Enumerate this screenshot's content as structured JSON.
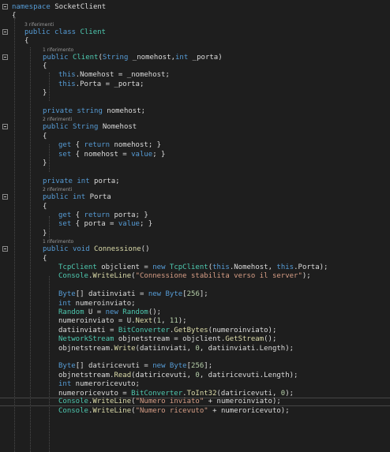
{
  "editor": {
    "lines": [
      {
        "indent": 0,
        "tokens": [
          [
            "kw",
            "namespace"
          ],
          [
            "plain",
            " SocketClient"
          ]
        ]
      },
      {
        "indent": 0,
        "tokens": [
          [
            "punct",
            "{"
          ]
        ]
      },
      {
        "lens": "3 riferimenti"
      },
      {
        "indent": 1,
        "tokens": [
          [
            "kw",
            "public"
          ],
          [
            "plain",
            " "
          ],
          [
            "kw",
            "class"
          ],
          [
            "plain",
            " "
          ],
          [
            "type",
            "Client"
          ]
        ]
      },
      {
        "indent": 1,
        "tokens": [
          [
            "punct",
            "{"
          ]
        ]
      },
      {
        "lens": "1 riferimento"
      },
      {
        "indent": 2,
        "tokens": [
          [
            "kw",
            "public"
          ],
          [
            "plain",
            " "
          ],
          [
            "type",
            "Client"
          ],
          [
            "punct",
            "("
          ],
          [
            "kw",
            "String"
          ],
          [
            "plain",
            " _nomehost,"
          ],
          [
            "kw",
            "int"
          ],
          [
            "plain",
            " _porta)"
          ]
        ]
      },
      {
        "indent": 2,
        "tokens": [
          [
            "punct",
            "{"
          ]
        ]
      },
      {
        "indent": 3,
        "tokens": [
          [
            "kw",
            "this"
          ],
          [
            "plain",
            ".Nomehost = _nomehost;"
          ]
        ]
      },
      {
        "indent": 3,
        "tokens": [
          [
            "kw",
            "this"
          ],
          [
            "plain",
            ".Porta = _porta;"
          ]
        ]
      },
      {
        "indent": 2,
        "tokens": [
          [
            "punct",
            "}"
          ]
        ]
      },
      {
        "indent": 0,
        "tokens": []
      },
      {
        "indent": 2,
        "tokens": [
          [
            "kw",
            "private"
          ],
          [
            "plain",
            " "
          ],
          [
            "kw",
            "string"
          ],
          [
            "plain",
            " nomehost;"
          ]
        ]
      },
      {
        "lens": "2 riferimenti"
      },
      {
        "indent": 2,
        "tokens": [
          [
            "kw",
            "public"
          ],
          [
            "plain",
            " "
          ],
          [
            "kw",
            "String"
          ],
          [
            "plain",
            " Nomehost"
          ]
        ]
      },
      {
        "indent": 2,
        "tokens": [
          [
            "punct",
            "{"
          ]
        ]
      },
      {
        "indent": 3,
        "tokens": [
          [
            "kw",
            "get"
          ],
          [
            "plain",
            " { "
          ],
          [
            "kw",
            "return"
          ],
          [
            "plain",
            " nomehost; }"
          ]
        ]
      },
      {
        "indent": 3,
        "tokens": [
          [
            "kw",
            "set"
          ],
          [
            "plain",
            " { nomehost = "
          ],
          [
            "kw",
            "value"
          ],
          [
            "plain",
            "; }"
          ]
        ]
      },
      {
        "indent": 2,
        "tokens": [
          [
            "punct",
            "}"
          ]
        ]
      },
      {
        "indent": 0,
        "tokens": []
      },
      {
        "indent": 2,
        "tokens": [
          [
            "kw",
            "private"
          ],
          [
            "plain",
            " "
          ],
          [
            "kw",
            "int"
          ],
          [
            "plain",
            " porta;"
          ]
        ]
      },
      {
        "lens": "2 riferimenti"
      },
      {
        "indent": 2,
        "tokens": [
          [
            "kw",
            "public"
          ],
          [
            "plain",
            " "
          ],
          [
            "kw",
            "int"
          ],
          [
            "plain",
            " Porta"
          ]
        ]
      },
      {
        "indent": 2,
        "tokens": [
          [
            "punct",
            "{"
          ]
        ]
      },
      {
        "indent": 3,
        "tokens": [
          [
            "kw",
            "get"
          ],
          [
            "plain",
            " { "
          ],
          [
            "kw",
            "return"
          ],
          [
            "plain",
            " porta; }"
          ]
        ]
      },
      {
        "indent": 3,
        "tokens": [
          [
            "kw",
            "set"
          ],
          [
            "plain",
            " { porta = "
          ],
          [
            "kw",
            "value"
          ],
          [
            "plain",
            "; }"
          ]
        ]
      },
      {
        "indent": 2,
        "tokens": [
          [
            "punct",
            "}"
          ]
        ]
      },
      {
        "lens": "1 riferimento"
      },
      {
        "indent": 2,
        "tokens": [
          [
            "kw",
            "public"
          ],
          [
            "plain",
            " "
          ],
          [
            "kw",
            "void"
          ],
          [
            "plain",
            " "
          ],
          [
            "method",
            "Connessione"
          ],
          [
            "plain",
            "()"
          ]
        ]
      },
      {
        "indent": 2,
        "tokens": [
          [
            "punct",
            "{"
          ]
        ]
      },
      {
        "indent": 3,
        "tokens": [
          [
            "type",
            "TcpClient"
          ],
          [
            "plain",
            " objclient = "
          ],
          [
            "kw",
            "new"
          ],
          [
            "plain",
            " "
          ],
          [
            "type",
            "TcpClient"
          ],
          [
            "plain",
            "("
          ],
          [
            "kw",
            "this"
          ],
          [
            "plain",
            ".Nomehost, "
          ],
          [
            "kw",
            "this"
          ],
          [
            "plain",
            ".Porta);"
          ]
        ]
      },
      {
        "indent": 3,
        "tokens": [
          [
            "type",
            "Console"
          ],
          [
            "plain",
            "."
          ],
          [
            "method",
            "WriteLine"
          ],
          [
            "plain",
            "("
          ],
          [
            "str",
            "\"Connessione stabilita verso il server\""
          ],
          [
            "plain",
            ");"
          ]
        ]
      },
      {
        "indent": 0,
        "tokens": []
      },
      {
        "indent": 3,
        "tokens": [
          [
            "kw",
            "Byte"
          ],
          [
            "plain",
            "[] datiinviati = "
          ],
          [
            "kw",
            "new"
          ],
          [
            "plain",
            " "
          ],
          [
            "kw",
            "Byte"
          ],
          [
            "plain",
            "["
          ],
          [
            "num",
            "256"
          ],
          [
            "plain",
            "];"
          ]
        ]
      },
      {
        "indent": 3,
        "tokens": [
          [
            "kw",
            "int"
          ],
          [
            "plain",
            " numeroinviato;"
          ]
        ]
      },
      {
        "indent": 3,
        "tokens": [
          [
            "type",
            "Random"
          ],
          [
            "plain",
            " U = "
          ],
          [
            "kw",
            "new"
          ],
          [
            "plain",
            " "
          ],
          [
            "type",
            "Random"
          ],
          [
            "plain",
            "();"
          ]
        ]
      },
      {
        "indent": 3,
        "tokens": [
          [
            "plain",
            "numeroinviato = U."
          ],
          [
            "method",
            "Next"
          ],
          [
            "plain",
            "("
          ],
          [
            "num",
            "1"
          ],
          [
            "plain",
            ", "
          ],
          [
            "num",
            "11"
          ],
          [
            "plain",
            ");"
          ]
        ]
      },
      {
        "indent": 3,
        "tokens": [
          [
            "plain",
            "datiinviati = "
          ],
          [
            "type",
            "BitConverter"
          ],
          [
            "plain",
            "."
          ],
          [
            "method",
            "GetBytes"
          ],
          [
            "plain",
            "(numeroinviato);"
          ]
        ]
      },
      {
        "indent": 3,
        "tokens": [
          [
            "type",
            "NetworkStream"
          ],
          [
            "plain",
            " objnetstream = objclient."
          ],
          [
            "method",
            "GetStream"
          ],
          [
            "plain",
            "();"
          ]
        ]
      },
      {
        "indent": 3,
        "tokens": [
          [
            "plain",
            "objnetstream."
          ],
          [
            "method",
            "Write"
          ],
          [
            "plain",
            "(datiinviati, "
          ],
          [
            "num",
            "0"
          ],
          [
            "plain",
            ", datiinviati.Length);"
          ]
        ]
      },
      {
        "indent": 0,
        "tokens": []
      },
      {
        "indent": 3,
        "tokens": [
          [
            "kw",
            "Byte"
          ],
          [
            "plain",
            "[] datiricevuti = "
          ],
          [
            "kw",
            "new"
          ],
          [
            "plain",
            " "
          ],
          [
            "kw",
            "Byte"
          ],
          [
            "plain",
            "["
          ],
          [
            "num",
            "256"
          ],
          [
            "plain",
            "];"
          ]
        ]
      },
      {
        "indent": 3,
        "tokens": [
          [
            "plain",
            "objnetstream."
          ],
          [
            "method",
            "Read"
          ],
          [
            "plain",
            "(datiricevuti, "
          ],
          [
            "num",
            "0"
          ],
          [
            "plain",
            ", datiricevuti.Length);"
          ]
        ]
      },
      {
        "indent": 3,
        "tokens": [
          [
            "kw",
            "int"
          ],
          [
            "plain",
            " numeroricevuto;"
          ]
        ]
      },
      {
        "indent": 3,
        "tokens": [
          [
            "plain",
            "numeroricevuto = "
          ],
          [
            "type",
            "BitConverter"
          ],
          [
            "plain",
            "."
          ],
          [
            "method",
            "ToInt32"
          ],
          [
            "plain",
            "(datiricevuti, "
          ],
          [
            "num",
            "0"
          ],
          [
            "plain",
            ");"
          ]
        ]
      },
      {
        "indent": 3,
        "current": true,
        "tokens": [
          [
            "type",
            "Console"
          ],
          [
            "plain",
            "."
          ],
          [
            "method",
            "WriteLine"
          ],
          [
            "plain",
            "("
          ],
          [
            "str",
            "\"Numero inviato\""
          ],
          [
            "plain",
            " + numeroinviato);"
          ]
        ]
      },
      {
        "indent": 3,
        "tokens": [
          [
            "type",
            "Console"
          ],
          [
            "plain",
            "."
          ],
          [
            "method",
            "WriteLine"
          ],
          [
            "plain",
            "("
          ],
          [
            "str",
            "\"Numero ricevuto\""
          ],
          [
            "plain",
            " + numeroricevuto);"
          ]
        ]
      }
    ]
  },
  "colors": {
    "background": "#1e1e1e",
    "keyword": "#569cd6",
    "type": "#4ec9b0",
    "string": "#d69d85",
    "number": "#b5cea8",
    "method": "#dcdcaa",
    "text": "#dcdcdc",
    "codelens": "#9a9a9a"
  }
}
